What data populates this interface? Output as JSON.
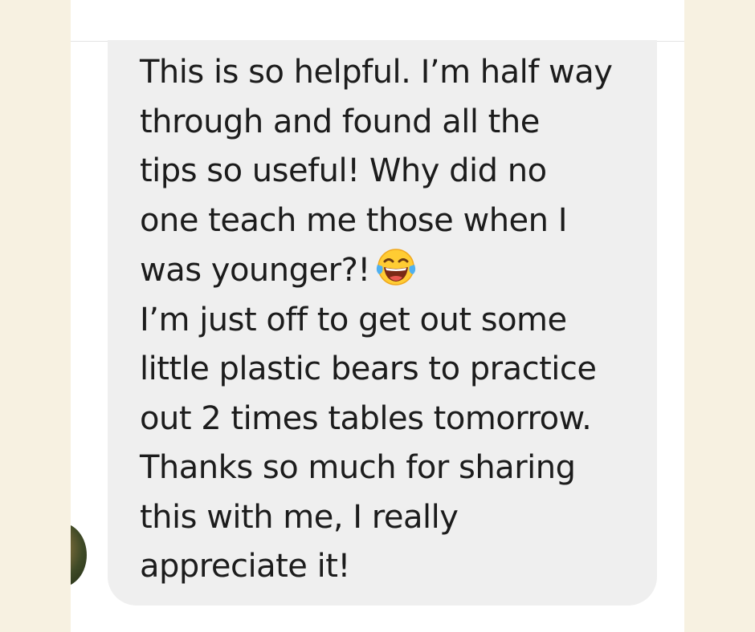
{
  "message": {
    "lines": [
      "This is so helpful. I’m half way",
      "through and found all the",
      "tips so useful! Why did no",
      "one teach me those when I",
      "was younger?!",
      "I’m just off to get out some",
      "little plastic bears to practice",
      "out 2 times tables tomorrow.",
      "Thanks so much for sharing",
      "this with me, I really",
      "appreciate it!"
    ],
    "emoji": "face-with-tears-of-joy"
  },
  "colors": {
    "background": "#f7f1e1",
    "panel": "#ffffff",
    "bubble": "#efefef",
    "text": "#1c1c1c"
  }
}
